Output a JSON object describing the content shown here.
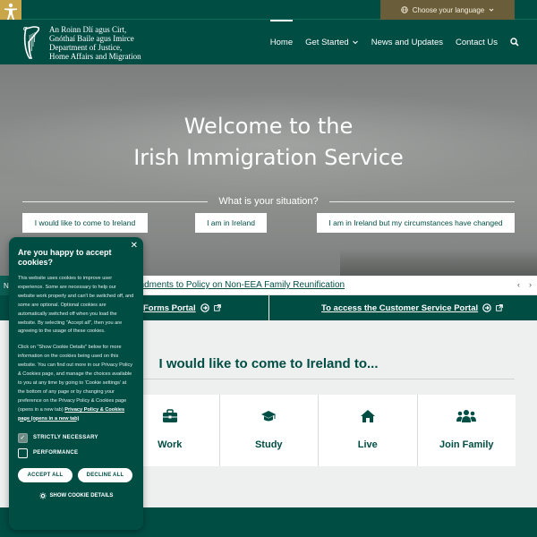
{
  "top_bar": {
    "language_label": "Choose your language"
  },
  "header": {
    "logo_lines": [
      "An Roinn Dlí agus Cirt,",
      "Gnóthaí Baile agus Imirce",
      "Department of Justice,",
      "Home Affairs and Migration"
    ],
    "nav": [
      {
        "label": "Home",
        "active": true
      },
      {
        "label": "Get Started",
        "has_dropdown": true
      },
      {
        "label": "News and Updates"
      },
      {
        "label": "Contact Us"
      }
    ]
  },
  "hero": {
    "title_line1": "Welcome to the",
    "title_line2": "Irish Immigration Service",
    "situation_label": "What is your situation?",
    "buttons": [
      "I would like to come to Ireland",
      "I am in Ireland",
      "I am in Ireland but my circumstances have changed"
    ]
  },
  "ticker": {
    "tag": "N",
    "text": "endments to Policy on Non-EEA Family Reunification"
  },
  "portals": {
    "left": "Forms Portal",
    "right": "To access the Customer Service Portal"
  },
  "section": {
    "title": "I would like to come to Ireland to...",
    "cards": [
      {
        "label": "Work",
        "icon": "briefcase-icon"
      },
      {
        "label": "Study",
        "icon": "graduation-cap-icon"
      },
      {
        "label": "Live",
        "icon": "home-icon"
      },
      {
        "label": "Join Family",
        "icon": "family-icon"
      }
    ]
  },
  "cookie": {
    "title": "Are you happy to accept cookies?",
    "body1": "This website uses cookies to improve user experience. Some are necessary to help our website work properly and can't be switched off, and some are optional. Optional cookies are automatically switched off when you load the website. By selecting \"Accept all\", then you are agreeing to the usage of these cookies.",
    "body2": "Click on \"Show Cookie Details\" below for more information on the cookies being used on this website. You can find out more in our Privacy Policy & Cookies page, and manage the choices available to you at any time by going to 'Cookie settings' at the bottom of any page or by changing your preference on the Privacy Policy & Cookies page (opens in a new tab)",
    "body2_link": "Privacy Policy & Cookies page (opens in a new tab)",
    "option_strict": "STRICTLY NECESSARY",
    "option_performance": "PERFORMANCE",
    "accept_label": "ACCEPT ALL",
    "decline_label": "DECLINE ALL",
    "details_label": "SHOW COOKIE DETAILS"
  },
  "colors": {
    "brand_green": "#004d44",
    "accent_gold": "#c9a64a"
  }
}
